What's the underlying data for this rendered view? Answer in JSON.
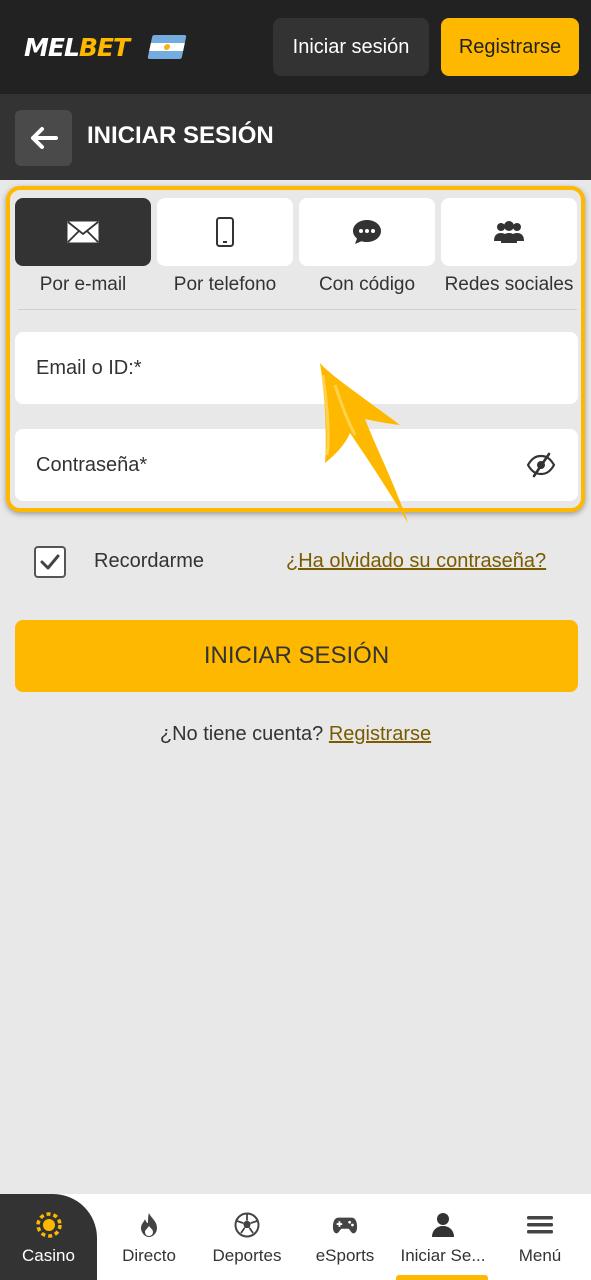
{
  "header": {
    "logo_left": "MEL",
    "logo_right": "BET",
    "login_label": "Iniciar sesión",
    "register_label": "Registrarse"
  },
  "titlebar": {
    "title": "INICIAR SESIÓN"
  },
  "tabs": [
    {
      "label": "Por e-mail",
      "icon": "envelope-icon",
      "active": true
    },
    {
      "label": "Por telefono",
      "icon": "phone-icon",
      "active": false
    },
    {
      "label": "Con código",
      "icon": "chat-bubble-icon",
      "active": false
    },
    {
      "label": "Redes sociales",
      "icon": "users-icon",
      "active": false
    }
  ],
  "form": {
    "email_placeholder": "Email o ID:*",
    "password_placeholder": "Contraseña*",
    "remember_label": "Recordarme",
    "remember_checked": true,
    "forgot_label": "¿Ha olvidado su contraseña?",
    "submit_label": "INICIAR SESIÓN",
    "no_account_label": "¿No tiene cuenta?",
    "register_link": "Registrarse"
  },
  "bottom_nav": [
    {
      "label": "Casino",
      "icon": "casino-chip-icon"
    },
    {
      "label": "Directo",
      "icon": "fire-icon"
    },
    {
      "label": "Deportes",
      "icon": "soccer-ball-icon"
    },
    {
      "label": "eSports",
      "icon": "gamepad-icon"
    },
    {
      "label": "Iniciar Se...",
      "icon": "user-icon",
      "active": true
    },
    {
      "label": "Menú",
      "icon": "hamburger-icon"
    }
  ],
  "colors": {
    "accent": "#ffb800",
    "dark": "#222222",
    "panel": "#333333",
    "background": "#e8e8e8",
    "link": "#7a5b00"
  }
}
